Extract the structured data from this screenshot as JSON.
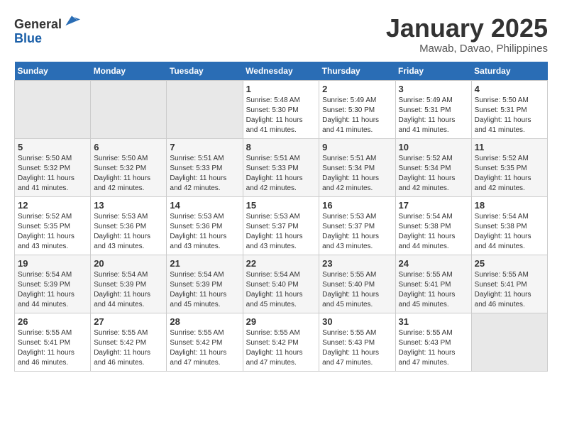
{
  "header": {
    "logo_line1": "General",
    "logo_line2": "Blue",
    "month_title": "January 2025",
    "location": "Mawab, Davao, Philippines"
  },
  "days_of_week": [
    "Sunday",
    "Monday",
    "Tuesday",
    "Wednesday",
    "Thursday",
    "Friday",
    "Saturday"
  ],
  "weeks": [
    [
      {
        "day": "",
        "sunrise": "",
        "sunset": "",
        "daylight": "",
        "empty": true
      },
      {
        "day": "",
        "sunrise": "",
        "sunset": "",
        "daylight": "",
        "empty": true
      },
      {
        "day": "",
        "sunrise": "",
        "sunset": "",
        "daylight": "",
        "empty": true
      },
      {
        "day": "1",
        "sunrise": "Sunrise: 5:48 AM",
        "sunset": "Sunset: 5:30 PM",
        "daylight": "Daylight: 11 hours and 41 minutes.",
        "empty": false
      },
      {
        "day": "2",
        "sunrise": "Sunrise: 5:49 AM",
        "sunset": "Sunset: 5:30 PM",
        "daylight": "Daylight: 11 hours and 41 minutes.",
        "empty": false
      },
      {
        "day": "3",
        "sunrise": "Sunrise: 5:49 AM",
        "sunset": "Sunset: 5:31 PM",
        "daylight": "Daylight: 11 hours and 41 minutes.",
        "empty": false
      },
      {
        "day": "4",
        "sunrise": "Sunrise: 5:50 AM",
        "sunset": "Sunset: 5:31 PM",
        "daylight": "Daylight: 11 hours and 41 minutes.",
        "empty": false
      }
    ],
    [
      {
        "day": "5",
        "sunrise": "Sunrise: 5:50 AM",
        "sunset": "Sunset: 5:32 PM",
        "daylight": "Daylight: 11 hours and 41 minutes.",
        "empty": false
      },
      {
        "day": "6",
        "sunrise": "Sunrise: 5:50 AM",
        "sunset": "Sunset: 5:32 PM",
        "daylight": "Daylight: 11 hours and 42 minutes.",
        "empty": false
      },
      {
        "day": "7",
        "sunrise": "Sunrise: 5:51 AM",
        "sunset": "Sunset: 5:33 PM",
        "daylight": "Daylight: 11 hours and 42 minutes.",
        "empty": false
      },
      {
        "day": "8",
        "sunrise": "Sunrise: 5:51 AM",
        "sunset": "Sunset: 5:33 PM",
        "daylight": "Daylight: 11 hours and 42 minutes.",
        "empty": false
      },
      {
        "day": "9",
        "sunrise": "Sunrise: 5:51 AM",
        "sunset": "Sunset: 5:34 PM",
        "daylight": "Daylight: 11 hours and 42 minutes.",
        "empty": false
      },
      {
        "day": "10",
        "sunrise": "Sunrise: 5:52 AM",
        "sunset": "Sunset: 5:34 PM",
        "daylight": "Daylight: 11 hours and 42 minutes.",
        "empty": false
      },
      {
        "day": "11",
        "sunrise": "Sunrise: 5:52 AM",
        "sunset": "Sunset: 5:35 PM",
        "daylight": "Daylight: 11 hours and 42 minutes.",
        "empty": false
      }
    ],
    [
      {
        "day": "12",
        "sunrise": "Sunrise: 5:52 AM",
        "sunset": "Sunset: 5:35 PM",
        "daylight": "Daylight: 11 hours and 43 minutes.",
        "empty": false
      },
      {
        "day": "13",
        "sunrise": "Sunrise: 5:53 AM",
        "sunset": "Sunset: 5:36 PM",
        "daylight": "Daylight: 11 hours and 43 minutes.",
        "empty": false
      },
      {
        "day": "14",
        "sunrise": "Sunrise: 5:53 AM",
        "sunset": "Sunset: 5:36 PM",
        "daylight": "Daylight: 11 hours and 43 minutes.",
        "empty": false
      },
      {
        "day": "15",
        "sunrise": "Sunrise: 5:53 AM",
        "sunset": "Sunset: 5:37 PM",
        "daylight": "Daylight: 11 hours and 43 minutes.",
        "empty": false
      },
      {
        "day": "16",
        "sunrise": "Sunrise: 5:53 AM",
        "sunset": "Sunset: 5:37 PM",
        "daylight": "Daylight: 11 hours and 43 minutes.",
        "empty": false
      },
      {
        "day": "17",
        "sunrise": "Sunrise: 5:54 AM",
        "sunset": "Sunset: 5:38 PM",
        "daylight": "Daylight: 11 hours and 44 minutes.",
        "empty": false
      },
      {
        "day": "18",
        "sunrise": "Sunrise: 5:54 AM",
        "sunset": "Sunset: 5:38 PM",
        "daylight": "Daylight: 11 hours and 44 minutes.",
        "empty": false
      }
    ],
    [
      {
        "day": "19",
        "sunrise": "Sunrise: 5:54 AM",
        "sunset": "Sunset: 5:39 PM",
        "daylight": "Daylight: 11 hours and 44 minutes.",
        "empty": false
      },
      {
        "day": "20",
        "sunrise": "Sunrise: 5:54 AM",
        "sunset": "Sunset: 5:39 PM",
        "daylight": "Daylight: 11 hours and 44 minutes.",
        "empty": false
      },
      {
        "day": "21",
        "sunrise": "Sunrise: 5:54 AM",
        "sunset": "Sunset: 5:39 PM",
        "daylight": "Daylight: 11 hours and 45 minutes.",
        "empty": false
      },
      {
        "day": "22",
        "sunrise": "Sunrise: 5:54 AM",
        "sunset": "Sunset: 5:40 PM",
        "daylight": "Daylight: 11 hours and 45 minutes.",
        "empty": false
      },
      {
        "day": "23",
        "sunrise": "Sunrise: 5:55 AM",
        "sunset": "Sunset: 5:40 PM",
        "daylight": "Daylight: 11 hours and 45 minutes.",
        "empty": false
      },
      {
        "day": "24",
        "sunrise": "Sunrise: 5:55 AM",
        "sunset": "Sunset: 5:41 PM",
        "daylight": "Daylight: 11 hours and 45 minutes.",
        "empty": false
      },
      {
        "day": "25",
        "sunrise": "Sunrise: 5:55 AM",
        "sunset": "Sunset: 5:41 PM",
        "daylight": "Daylight: 11 hours and 46 minutes.",
        "empty": false
      }
    ],
    [
      {
        "day": "26",
        "sunrise": "Sunrise: 5:55 AM",
        "sunset": "Sunset: 5:41 PM",
        "daylight": "Daylight: 11 hours and 46 minutes.",
        "empty": false
      },
      {
        "day": "27",
        "sunrise": "Sunrise: 5:55 AM",
        "sunset": "Sunset: 5:42 PM",
        "daylight": "Daylight: 11 hours and 46 minutes.",
        "empty": false
      },
      {
        "day": "28",
        "sunrise": "Sunrise: 5:55 AM",
        "sunset": "Sunset: 5:42 PM",
        "daylight": "Daylight: 11 hours and 47 minutes.",
        "empty": false
      },
      {
        "day": "29",
        "sunrise": "Sunrise: 5:55 AM",
        "sunset": "Sunset: 5:42 PM",
        "daylight": "Daylight: 11 hours and 47 minutes.",
        "empty": false
      },
      {
        "day": "30",
        "sunrise": "Sunrise: 5:55 AM",
        "sunset": "Sunset: 5:43 PM",
        "daylight": "Daylight: 11 hours and 47 minutes.",
        "empty": false
      },
      {
        "day": "31",
        "sunrise": "Sunrise: 5:55 AM",
        "sunset": "Sunset: 5:43 PM",
        "daylight": "Daylight: 11 hours and 47 minutes.",
        "empty": false
      },
      {
        "day": "",
        "sunrise": "",
        "sunset": "",
        "daylight": "",
        "empty": true
      }
    ]
  ]
}
